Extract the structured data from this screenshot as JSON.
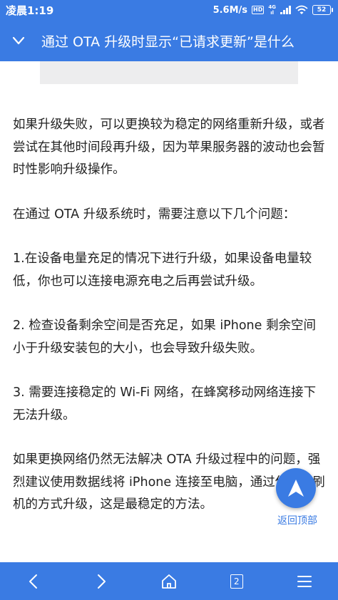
{
  "status": {
    "time": "凌晨1:19",
    "speed": "5.6M/s",
    "hd": "HD",
    "net_type_top": "4G",
    "net_type_bottom": "ıl",
    "battery": "52"
  },
  "header": {
    "title": "通过 OTA 升级时显示“已请求更新”是什么"
  },
  "article": {
    "paragraphs": [
      "如果升级失败，可以更换较为稳定的网络重新升级，或者尝试在其他时间段再升级，因为苹果服务器的波动也会暂时性影响升级操作。",
      "在通过 OTA 升级系统时，需要注意以下几个问题：",
      "1.在设备电量充足的情况下进行升级，如果设备电量较低，你也可以连接电源充电之后再尝试升级。",
      "2. 检查设备剩余空间是否充足，如果 iPhone 剩余空间小于升级安装包的大小，也会导致升级失败。",
      "3. 需要连接稳定的 Wi-Fi 网络，在蜂窝移动网络连接下无法升级。",
      "如果更换网络仍然无法解决 OTA 升级过程中的问题，强烈建议使用数据线将 iPhone 连接至电脑，通过保资料刷机的方式升级，这是最稳定的方法。"
    ]
  },
  "fab": {
    "label": "返回顶部"
  },
  "nav": {
    "tab_count": "2"
  },
  "colors": {
    "accent": "#3a7be3"
  }
}
